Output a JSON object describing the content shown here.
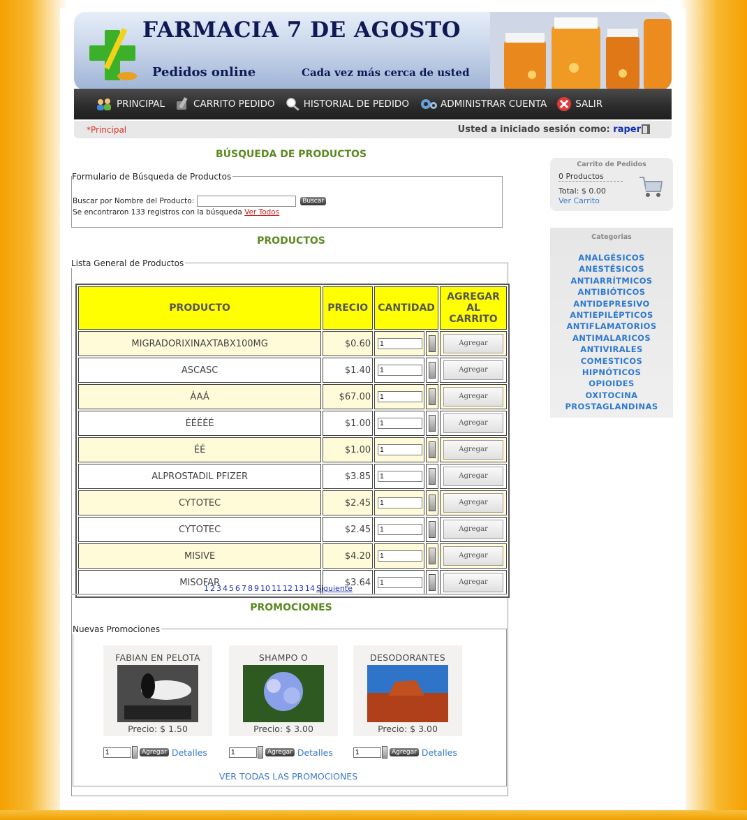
{
  "header": {
    "title": "FARMACIA 7 DE AGOSTO",
    "subtitle_left": "Pedidos online",
    "subtitle_right": "Cada vez más cerca de usted"
  },
  "nav": {
    "items": [
      {
        "label": "PRINCIPAL",
        "icon": "users-icon"
      },
      {
        "label": "CARRITO PEDIDO",
        "icon": "pencil-icon"
      },
      {
        "label": "HISTORIAL DE PEDIDO",
        "icon": "magnifier-icon"
      },
      {
        "label": "ADMINISTRAR CUENTA",
        "icon": "gear-icon"
      },
      {
        "label": "SALIR",
        "icon": "close-icon"
      }
    ]
  },
  "status": {
    "breadcrumb": "*Principal",
    "logged_as": "Usted a iniciado sesión como: ",
    "username": "raper"
  },
  "search": {
    "heading": "BÚSQUEDA DE PRODUCTOS",
    "legend": "Formulario de Búsqueda de Productos",
    "label": "Buscar por Nombre del Producto:",
    "input_value": "",
    "button": "Buscar",
    "result_text": "Se encontraron 133 registros con la búsqueda",
    "view_all": "Ver Todos"
  },
  "products": {
    "heading": "PRODUCTOS",
    "legend": "Lista General de Productos",
    "columns": [
      "PRODUCTO",
      "PRECIO",
      "CANTIDAD",
      "AGREGAR AL CARRITO"
    ],
    "rows": [
      {
        "name": "MIGRADORIXINAXTABX100MG",
        "price": "$0.60",
        "qty": "1",
        "action": "Agregar"
      },
      {
        "name": "ASCASC",
        "price": "$1.40",
        "qty": "1",
        "action": "Agregar"
      },
      {
        "name": "ÁAÁ",
        "price": "$67.00",
        "qty": "1",
        "action": "Agregar"
      },
      {
        "name": "ÉÉÉÉÉ",
        "price": "$1.00",
        "qty": "1",
        "action": "Agregar"
      },
      {
        "name": "ÉÉ",
        "price": "$1.00",
        "qty": "1",
        "action": "Agregar"
      },
      {
        "name": "ALPROSTADIL PFIZER",
        "price": "$3.85",
        "qty": "1",
        "action": "Agregar"
      },
      {
        "name": "CYTOTEC",
        "price": "$2.45",
        "qty": "1",
        "action": "Agregar"
      },
      {
        "name": "CYTOTEC",
        "price": "$2.45",
        "qty": "1",
        "action": "Agregar"
      },
      {
        "name": "MISIVE",
        "price": "$4.20",
        "qty": "1",
        "action": "Agregar"
      },
      {
        "name": "MISOFAR",
        "price": "$3.64",
        "qty": "1",
        "action": "Agregar"
      }
    ],
    "pages": [
      "1",
      "2",
      "3",
      "4",
      "5",
      "6",
      "7",
      "8",
      "9",
      "10",
      "11",
      "12",
      "13",
      "14"
    ],
    "next": "Siguiente"
  },
  "promotions": {
    "heading": "PROMOCIONES",
    "legend": "Nuevas Promociones",
    "items": [
      {
        "name": "FABIAN EN PELOTA",
        "price": "Precio: $ 1.50",
        "qty": "1",
        "button": "Agregar",
        "details": "Detalles"
      },
      {
        "name": "SHAMPO O",
        "price": "Precio: $ 3.00",
        "qty": "1",
        "button": "Agregar",
        "details": "Detalles"
      },
      {
        "name": "DESODORANTES",
        "price": "Precio: $ 3.00",
        "qty": "1",
        "button": "Agregar",
        "details": "Detalles"
      }
    ],
    "see_all": "VER TODAS LAS PROMOCIONES"
  },
  "cart": {
    "heading": "Carrito de Pedidos",
    "count": "0 Productos",
    "total": "Total: $ 0.00",
    "view": "Ver Carrito"
  },
  "categories": {
    "heading": "Categorias",
    "items": [
      "ANALGÉSICOS",
      "ANESTÉSICOS",
      "ANTIARRÍTMICOS",
      "ANTIBIÓTICOS",
      "ANTIDEPRESIVO",
      "ANTIEPILÉPTICOS",
      "ANTIFLAMATORIOS",
      "ANTIMALARICOS",
      "ANTIVIRALES",
      "COMESTICOS",
      "HIPNÓTICOS",
      "OPIOIDES",
      "OXITOCINA",
      "PROSTAGLANDINAS"
    ]
  },
  "colors": {
    "header_yellow": "#ffff00",
    "accent_green": "#5a8a20",
    "link_blue": "#2f7ad0",
    "breadcrumb_red": "#e0302a"
  }
}
